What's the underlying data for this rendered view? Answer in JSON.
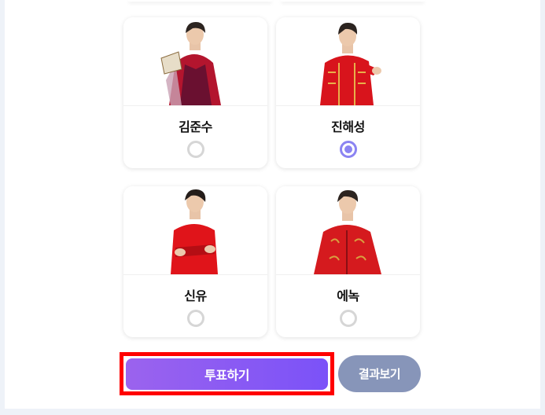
{
  "candidates": [
    {
      "name": "김준수",
      "selected": false,
      "outfit_color": "#b3152e"
    },
    {
      "name": "진해성",
      "selected": true,
      "outfit_color": "#d8141c"
    },
    {
      "name": "신유",
      "selected": false,
      "outfit_color": "#e0141a"
    },
    {
      "name": "에녹",
      "selected": false,
      "outfit_color": "#d51a1e"
    }
  ],
  "actions": {
    "vote_label": "투표하기",
    "results_label": "결과보기"
  },
  "colors": {
    "accent": "#8b84f2",
    "vote_gradient_start": "#9b63ee",
    "vote_gradient_end": "#7b52f8",
    "results_button": "#8795b9",
    "highlight_outline": "#ff0000"
  }
}
